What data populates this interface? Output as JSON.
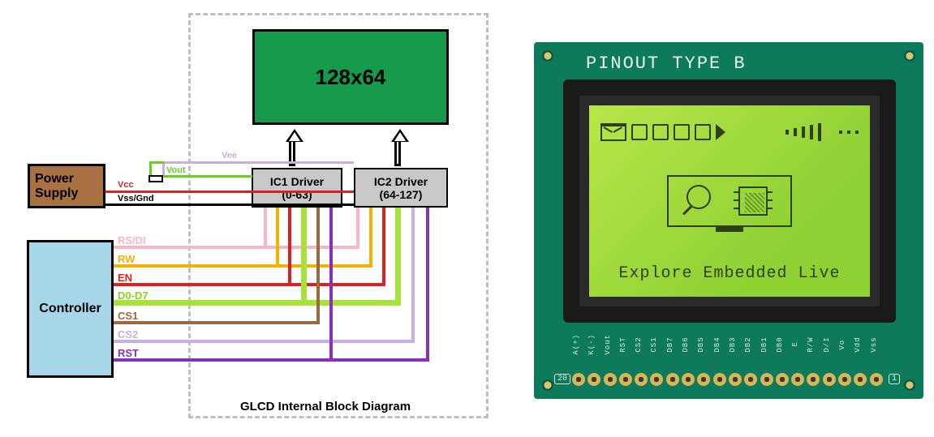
{
  "diagram": {
    "display": {
      "label": "128x64"
    },
    "ic1": {
      "line1": "IC1 Driver",
      "line2": "(0-63)"
    },
    "ic2": {
      "line1": "IC2 Driver",
      "line2": "(64-127)"
    },
    "power": {
      "line1": "Power",
      "line2": "Supply"
    },
    "controller": {
      "label": "Controller"
    },
    "caption": "GLCD Internal Block Diagram",
    "power_signals": {
      "vee": "Vee",
      "vout": "Vout",
      "vcc": "Vcc",
      "vss": "Vss/Gnd"
    },
    "ctrl_signals": {
      "rsdi": "RS/DI",
      "rw": "RW",
      "en": "EN",
      "data": "D0-D7",
      "cs1": "CS1",
      "cs2": "CS2",
      "rst": "RST"
    }
  },
  "colors": {
    "vee": "#c9aee4",
    "vout": "#66d11f",
    "vcc": "#e02020",
    "vss": "#000000",
    "rsdi": "#f7b6c8",
    "rw": "#f2b200",
    "en": "#e02020",
    "data": "#a6e23a",
    "cs1": "#9c6a3f",
    "cs2": "#c9aee4",
    "rst": "#8b2fb5"
  },
  "lcd_module": {
    "title": "PINOUT TYPE B",
    "screen_text": "Explore Embedded Live",
    "pin_count_left": "20",
    "pin_count_right": "1",
    "pins": [
      "Vss",
      "Vdd",
      "Vo",
      "D/I",
      "R/W",
      "E",
      "DB0",
      "DB1",
      "DB2",
      "DB3",
      "DB4",
      "DB5",
      "DB6",
      "DB7",
      "CS1",
      "CS2",
      "RST",
      "Vout",
      "K(-)",
      "A(+)"
    ]
  }
}
